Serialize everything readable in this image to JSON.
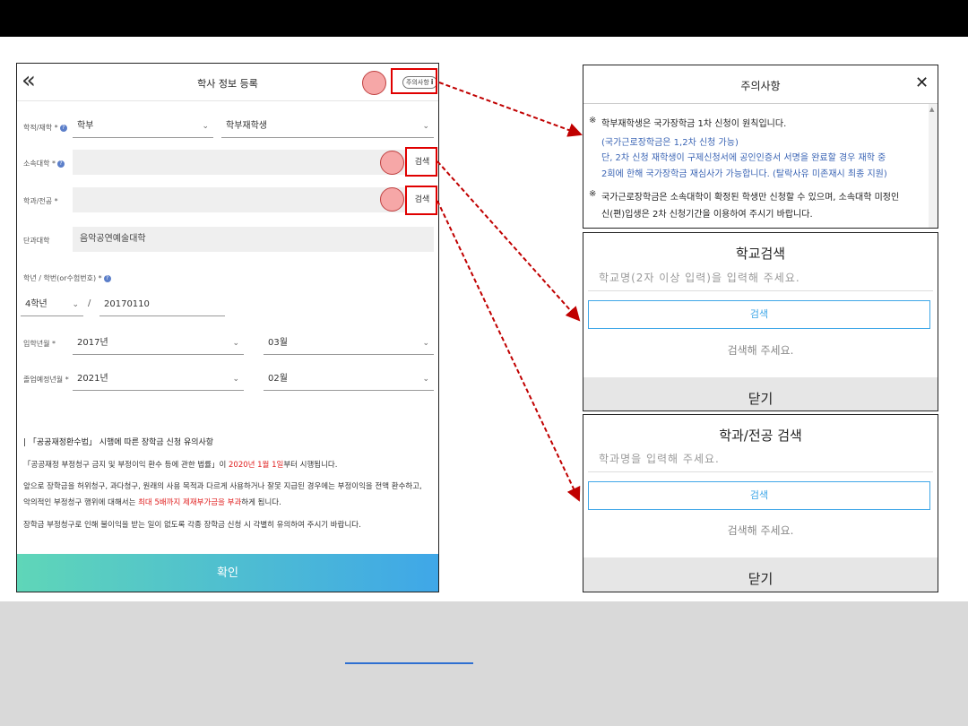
{
  "colors": {
    "accent_red": "#e00000",
    "confirm_start": "#5fd6b8",
    "confirm_end": "#3fa7e8",
    "link_blue": "#2e6fd1"
  },
  "left_panel": {
    "title": "학사 정보 등록",
    "back_icon": "double-chevron-left-icon",
    "notice_button": "주의사항",
    "notice_icon": "info-icon",
    "fields": {
      "status_label": "학적/재학 *",
      "status_value1": "학부",
      "status_value2": "학부재학생",
      "university_label": "소속대학 *",
      "university_search": "검색",
      "dept_label": "학과/전공 *",
      "dept_search": "검색",
      "college_label": "단과대학",
      "college_value": "음악공연예술대학",
      "grade_label": "학년 / 학번(or수험번호) *",
      "grade_value": "4학년",
      "grade_sep": "/",
      "student_id": "20170110",
      "enroll_label": "입학년월 *",
      "enroll_year": "2017년",
      "enroll_month": "03월",
      "grad_label": "졸업예정년월 *",
      "grad_year": "2021년",
      "grad_month": "02월"
    },
    "info": {
      "title": "| 「공공재정환수법」 시행에 따른 장학금 신청 유의사항",
      "line1_a": "「공공재정 부정청구 금지 및 부정이익 환수 등에 관한 법률」이 ",
      "line1_hl": "2020년 1월 1일",
      "line1_b": "부터 시행됩니다.",
      "line2": "앞으로 장학금을 허위청구, 과다청구, 원래의 사용 목적과 다르게 사용하거나 잘못 지급된 경우에는 부정이익을 전액 환수하고,",
      "line3_a": "악의적인 부정청구 행위에 대해서는 ",
      "line3_hl": "최대 5배까지 제재부가금을 부과",
      "line3_b": "하게 됩니다.",
      "line4": "장학금 부정청구로 인해 불이익을 받는 일이 없도록 각종 장학금 신청 시 각별히 유의하여 주시기 바랍니다."
    },
    "confirm": "확인"
  },
  "notice_panel": {
    "title": "주의사항",
    "close_icon": "close-icon",
    "bullet": "※",
    "lines": [
      "학부재학생은 국가장학금 1차 신청이 원칙입니다.",
      "(국가근로장학금은 1,2차 신청 가능)",
      "단, 2차 신청 재학생이 구제신청서에 공인인증서 서명을 완료할 경우 재학 중",
      "2회에 한해 국가장학금 재심사가 가능합니다. (탈락사유 미존재시 최종 지원)",
      "국가근로장학금은 소속대학이 확정된 학생만 신청할 수 있으며, 소속대학 미정인",
      "신(편)입생은 2차 신청기간을 이용하여 주시기 바랍니다."
    ]
  },
  "school_search": {
    "title": "학교검색",
    "placeholder": "학교명(2자 이상 입력)을 입력해 주세요.",
    "button": "검색",
    "empty": "검색해 주세요.",
    "close": "닫기"
  },
  "dept_search": {
    "title": "학과/전공 검색",
    "placeholder": "학과명을 입력해 주세요.",
    "button": "검색",
    "empty": "검색해 주세요.",
    "close": "닫기"
  }
}
